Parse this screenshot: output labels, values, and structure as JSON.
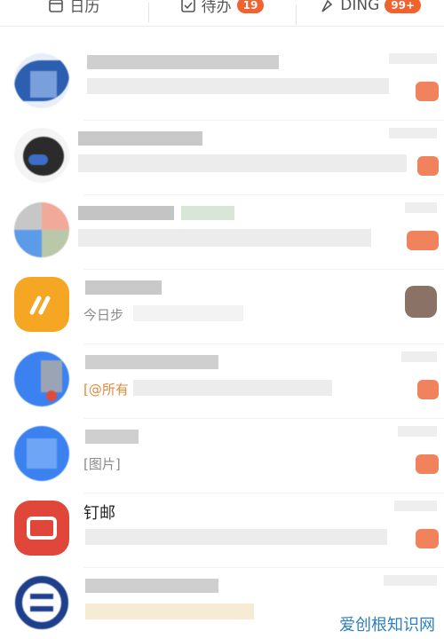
{
  "tabs": [
    {
      "label": "日历",
      "icon": "calendar-icon"
    },
    {
      "label": "待办",
      "icon": "todo-icon",
      "badge": "19"
    },
    {
      "label": "DING",
      "icon": "ding-icon",
      "badge": "99+"
    }
  ],
  "messages": [
    {
      "title": "",
      "preview": ""
    },
    {
      "title": "",
      "preview": ""
    },
    {
      "title": "",
      "preview": ""
    },
    {
      "title": "",
      "preview": "今日步"
    },
    {
      "title": "",
      "preview": "[@所有"
    },
    {
      "title": "",
      "preview": "[图片]"
    },
    {
      "title": "钉邮",
      "preview": ""
    },
    {
      "title": "",
      "preview": ""
    }
  ],
  "watermark": {
    "text": "爱创根知识网"
  },
  "colors": {
    "accent": "#f0632e",
    "blue": "#3a7bd5",
    "orange": "#f5a623",
    "red": "#e0463a"
  }
}
